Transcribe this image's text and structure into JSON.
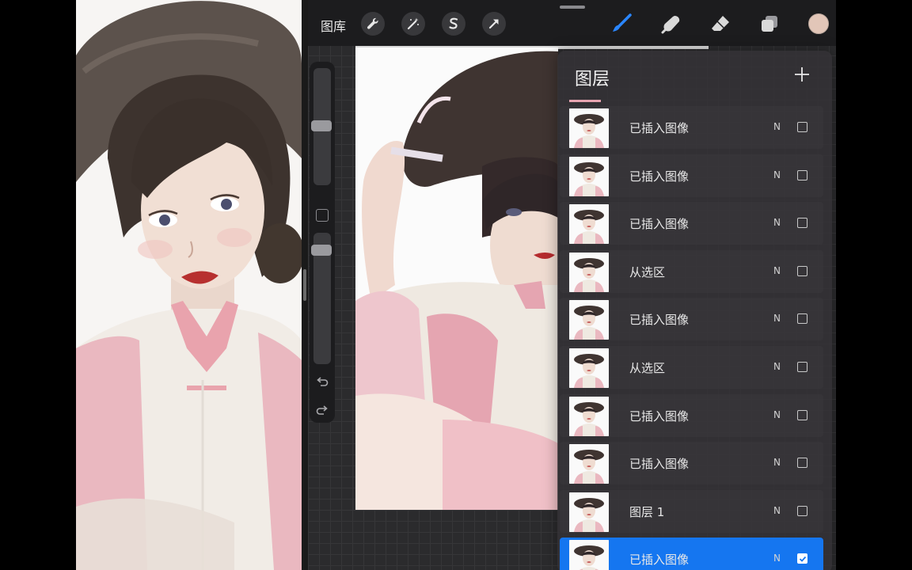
{
  "toolbar": {
    "gallery_label": "图库",
    "left_tools": [
      "wrench-icon",
      "magic-wand-icon",
      "selection-s-icon",
      "transform-arrow-icon"
    ],
    "right_tools": [
      "brush-icon",
      "smudge-icon",
      "eraser-icon",
      "layers-icon"
    ],
    "active_tool": "brush-icon",
    "current_color": "#e2c6b8"
  },
  "colors": {
    "accent": "#1576f0",
    "panel_bg": "#343236",
    "topbar_bg": "#1c1c1e"
  },
  "sidebar": {
    "icons": [
      "modify-button-icon",
      "undo-icon",
      "redo-icon"
    ]
  },
  "layers": {
    "title": "图层",
    "add_icon": "plus-icon",
    "items": [
      {
        "name": "已插入图像",
        "blend": "N",
        "visible": false,
        "selected": false
      },
      {
        "name": "已插入图像",
        "blend": "N",
        "visible": false,
        "selected": false
      },
      {
        "name": "已插入图像",
        "blend": "N",
        "visible": false,
        "selected": false
      },
      {
        "name": "从选区",
        "blend": "N",
        "visible": false,
        "selected": false
      },
      {
        "name": "已插入图像",
        "blend": "N",
        "visible": false,
        "selected": false
      },
      {
        "name": "从选区",
        "blend": "N",
        "visible": false,
        "selected": false
      },
      {
        "name": "已插入图像",
        "blend": "N",
        "visible": false,
        "selected": false
      },
      {
        "name": "已插入图像",
        "blend": "N",
        "visible": false,
        "selected": false
      },
      {
        "name": "图层 1",
        "blend": "N",
        "visible": false,
        "selected": false
      },
      {
        "name": "已插入图像",
        "blend": "N",
        "visible": true,
        "selected": true
      }
    ]
  }
}
